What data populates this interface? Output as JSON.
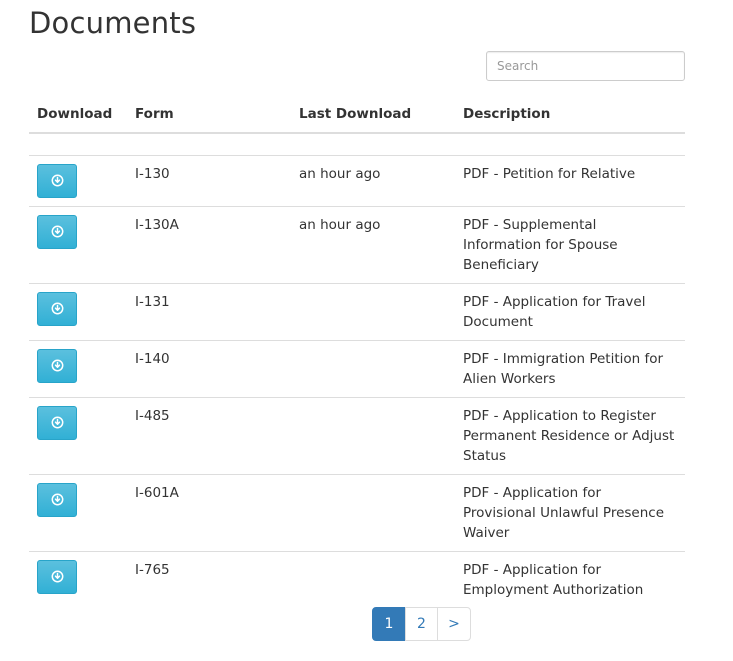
{
  "page": {
    "title": "Documents"
  },
  "search": {
    "placeholder": "Search",
    "value": ""
  },
  "table": {
    "columns": {
      "download": "Download",
      "form": "Form",
      "last_download": "Last Download",
      "description": "Description"
    },
    "rows": [
      {
        "icon": "download-circle-icon",
        "form": "I-130",
        "last_download": "an hour ago",
        "description": "PDF - Petition for Relative"
      },
      {
        "icon": "download-circle-icon",
        "form": "I-130A",
        "last_download": "an hour ago",
        "description": "PDF - Supplemental Information for Spouse Beneficiary"
      },
      {
        "icon": "download-circle-icon",
        "form": "I-131",
        "last_download": "",
        "description": "PDF - Application for Travel Document"
      },
      {
        "icon": "download-circle-icon",
        "form": "I-140",
        "last_download": "",
        "description": "PDF - Immigration Petition for Alien Workers"
      },
      {
        "icon": "download-circle-icon",
        "form": "I-485",
        "last_download": "",
        "description": "PDF - Application to Register Permanent Residence or Adjust Status"
      },
      {
        "icon": "download-circle-icon",
        "form": "I-601A",
        "last_download": "",
        "description": "PDF - Application for Provisional Unlawful Presence Waiver"
      },
      {
        "icon": "download-circle-icon",
        "form": "I-765",
        "last_download": "",
        "description": "PDF - Application for Employment Authorization"
      }
    ]
  },
  "pagination": {
    "pages": [
      "1",
      "2"
    ],
    "current": "1",
    "next_label": ">"
  },
  "colors": {
    "download_button": "#5bc0de",
    "pagination_active": "#337ab7",
    "link": "#337ab7"
  }
}
